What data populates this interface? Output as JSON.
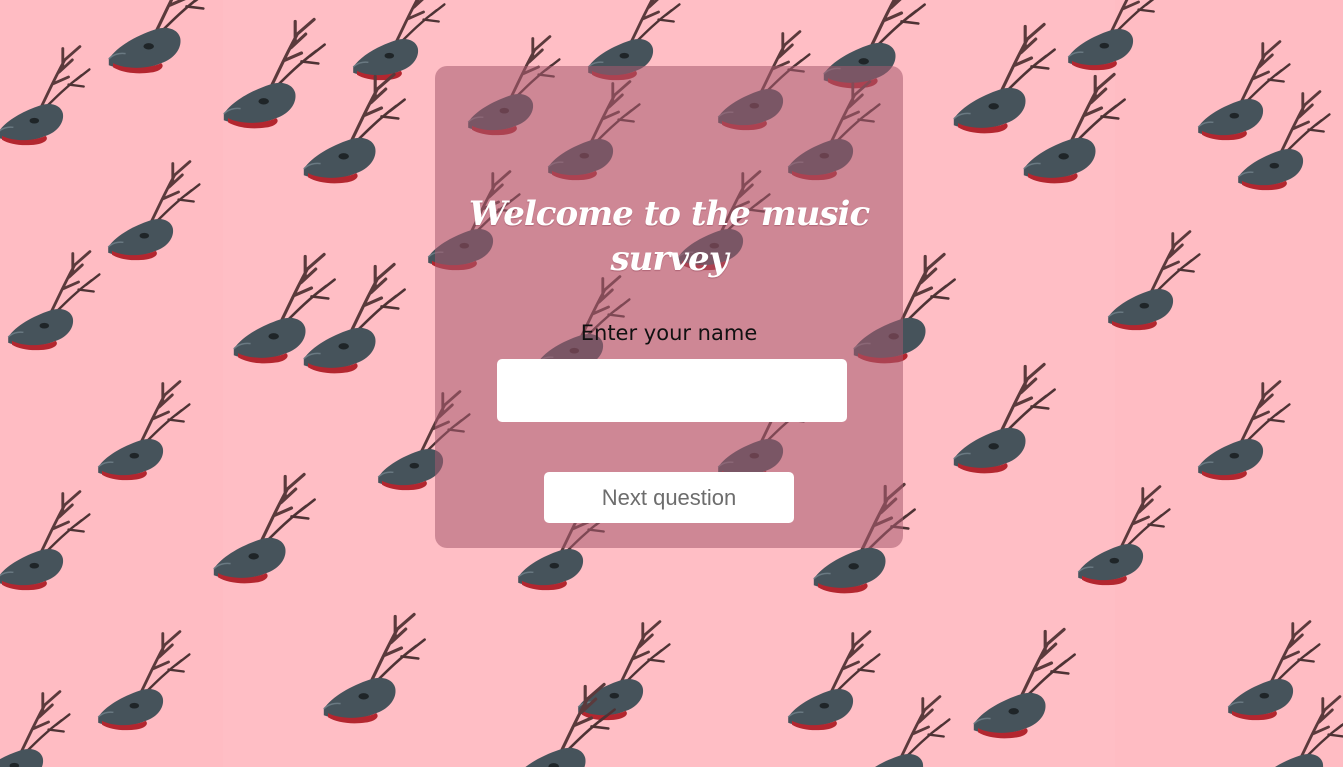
{
  "page": {
    "background_color": "#ffbcc3",
    "background_pattern": "deer-skull-with-antlers",
    "card_color": "rgba(165, 90, 110, 0.55)"
  },
  "card": {
    "title_lines": [
      "Welcome to the music",
      "survey"
    ],
    "name_label": "Enter your name",
    "name_input": {
      "value": "",
      "placeholder": ""
    },
    "next_button_label": "Next question"
  }
}
